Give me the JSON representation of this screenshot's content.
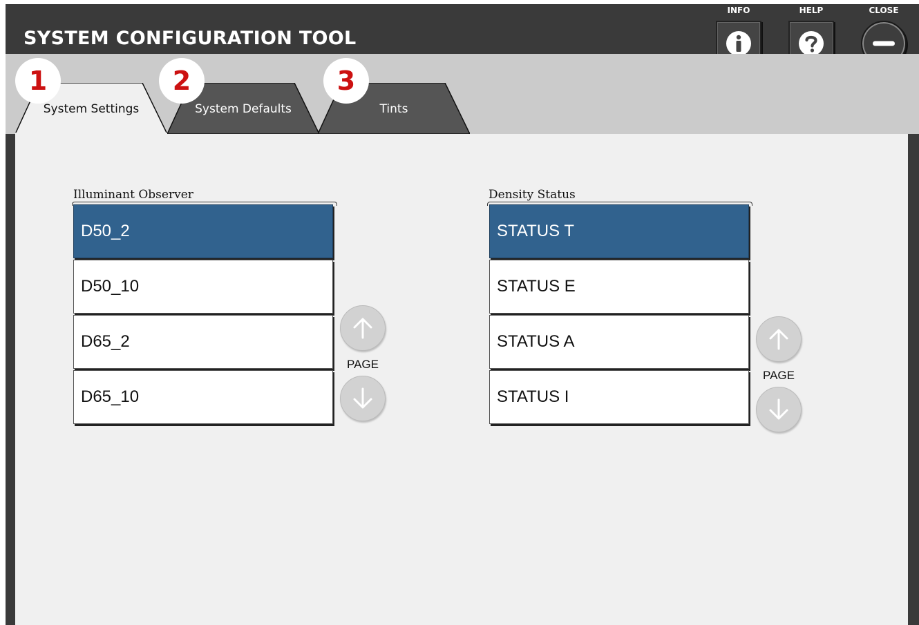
{
  "app": {
    "title": "SYSTEM CONFIGURATION TOOL"
  },
  "header_buttons": [
    {
      "caption": "INFO",
      "icon": "info-icon"
    },
    {
      "caption": "HELP",
      "icon": "help-icon"
    },
    {
      "caption": "CLOSE",
      "icon": "minus-icon"
    }
  ],
  "tabs": [
    {
      "number": "1",
      "label": "System Settings",
      "active": true
    },
    {
      "number": "2",
      "label": "System Defaults",
      "active": false
    },
    {
      "number": "3",
      "label": "Tints",
      "active": false
    }
  ],
  "illuminant": {
    "label": "Illuminant Observer",
    "items": [
      "D50_2",
      "D50_10",
      "D65_2",
      "D65_10"
    ],
    "selected": "D50_2",
    "page_label": "PAGE"
  },
  "density": {
    "label": "Density Status",
    "items": [
      "STATUS T",
      "STATUS E",
      "STATUS A",
      "STATUS I"
    ],
    "selected": "STATUS T",
    "page_label": "PAGE"
  },
  "colors": {
    "selected_item": "#31628e",
    "badge_number": "#cc1111",
    "header_bg": "#3a3a3a",
    "tabstrip_bg": "#cbcbcb",
    "content_bg": "#f0f0f0"
  }
}
